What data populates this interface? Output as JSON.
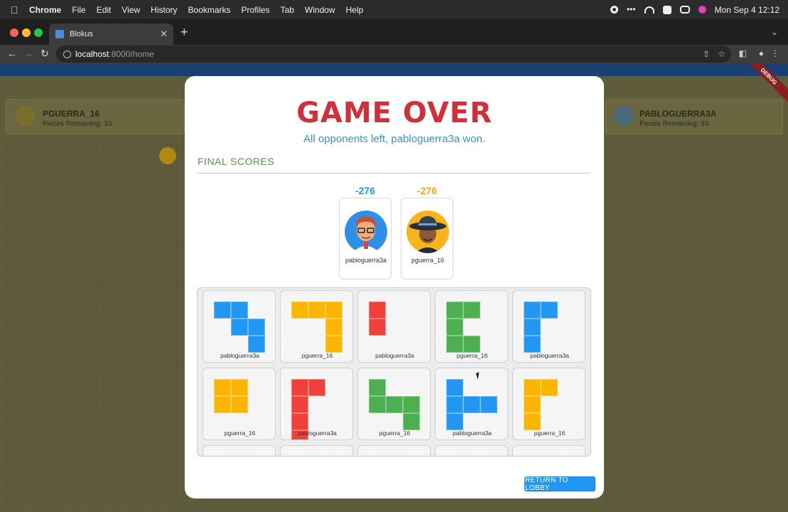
{
  "menubar": {
    "items": [
      "Chrome",
      "File",
      "Edit",
      "View",
      "History",
      "Bookmarks",
      "Profiles",
      "Tab",
      "Window",
      "Help"
    ],
    "clock": "Mon Sep 4  12:12"
  },
  "browser": {
    "tab_title": "Blokus",
    "url_host": "localhost",
    "url_path": ":8000/home"
  },
  "background_game": {
    "left_player": {
      "name": "PGUERRA_16",
      "pieces": "Pieces Remaining: 33"
    },
    "right_player": {
      "name": "PABLOGUERRA3A",
      "pieces": "Pieces Remaining: 33"
    },
    "debug_banner": "DEBUG"
  },
  "modal": {
    "title": "GAME OVER",
    "subtitle": "All opponents left, pabloguerra3a won.",
    "section_title": "FINAL SCORES",
    "players": [
      {
        "name": "pabloguerra3a",
        "score": "-276",
        "score_color": "#2196f3",
        "avatar": "red-haired-glasses-avatar"
      },
      {
        "name": "pguerra_16",
        "score": "-276",
        "score_color": "#f4a21a",
        "avatar": "hat-avatar"
      }
    ],
    "colors": {
      "blue": "#2196f3",
      "yellow": "#fbb500",
      "red": "#f0403a",
      "green": "#4caf50"
    },
    "pieces": [
      {
        "owner": "pabloguerra3a",
        "color": "blue"
      },
      {
        "owner": "pguerra_16",
        "color": "yellow"
      },
      {
        "owner": "pabloguerra3a",
        "color": "red"
      },
      {
        "owner": "pguerra_16",
        "color": "green"
      },
      {
        "owner": "pabloguerra3a",
        "color": "blue"
      },
      {
        "owner": "pguerra_16",
        "color": "yellow"
      },
      {
        "owner": "pabloguerra3a",
        "color": "red"
      },
      {
        "owner": "pguerra_16",
        "color": "green"
      },
      {
        "owner": "pabloguerra3a",
        "color": "blue"
      },
      {
        "owner": "pguerra_16",
        "color": "yellow"
      }
    ],
    "return_button": "RETURN TO LOBBY"
  }
}
